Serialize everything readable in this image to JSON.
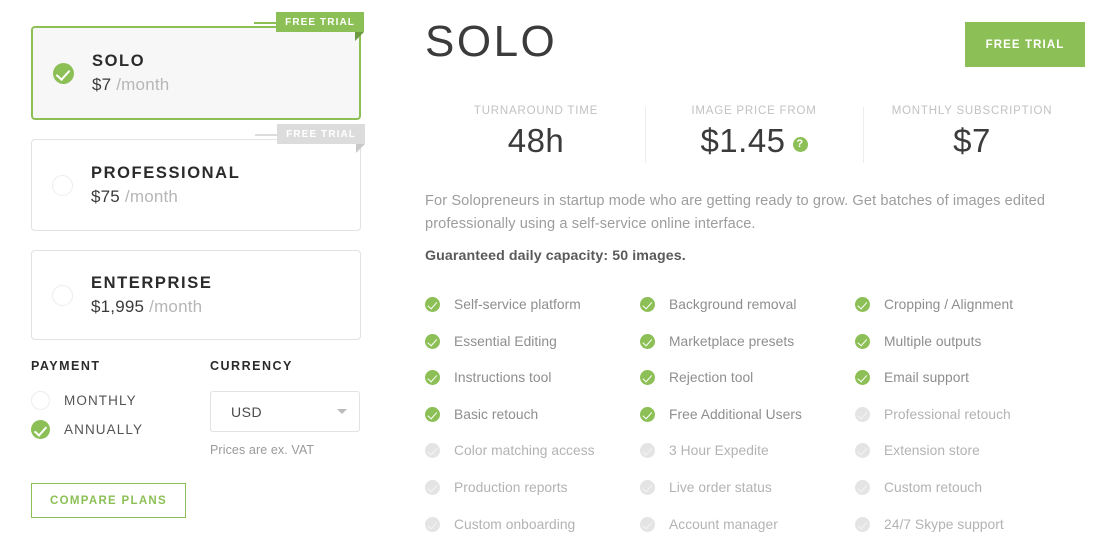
{
  "plans": [
    {
      "name": "SOLO",
      "price": "$7",
      "period": "/month",
      "badge": "FREE TRIAL",
      "selected": true,
      "badge_style": "green"
    },
    {
      "name": "PROFESSIONAL",
      "price": "$75",
      "period": "/month",
      "badge": "FREE TRIAL",
      "selected": false,
      "badge_style": "grey"
    },
    {
      "name": "ENTERPRISE",
      "price": "$1,995",
      "period": "/month",
      "badge": "",
      "selected": false,
      "badge_style": "none"
    }
  ],
  "payment": {
    "heading": "PAYMENT",
    "options": [
      {
        "label": "MONTHLY",
        "selected": false
      },
      {
        "label": "ANNUALLY",
        "selected": true
      }
    ]
  },
  "currency": {
    "heading": "CURRENCY",
    "selected": "USD",
    "options": [
      "USD"
    ],
    "note": "Prices are ex. VAT"
  },
  "compare_button": "COMPARE PLANS",
  "detail": {
    "title": "SOLO",
    "trial_button": "FREE TRIAL",
    "stats": [
      {
        "label": "TURNAROUND TIME",
        "value": "48h",
        "help": false
      },
      {
        "label": "IMAGE PRICE FROM",
        "value": "$1.45",
        "help": true,
        "help_glyph": "?"
      },
      {
        "label": "MONTHLY SUBSCRIPTION",
        "value": "$7",
        "help": false
      }
    ],
    "description": "For Solopreneurs in startup mode who are getting ready to grow. Get batches of images edited professionally using a self-service online interface.",
    "capacity": "Guaranteed daily capacity: 50 images.",
    "feature_columns": [
      [
        {
          "label": "Self-service platform",
          "included": true
        },
        {
          "label": "Essential Editing",
          "included": true
        },
        {
          "label": "Instructions tool",
          "included": true
        },
        {
          "label": "Basic retouch",
          "included": true
        },
        {
          "label": "Color matching access",
          "included": false
        },
        {
          "label": "Production reports",
          "included": false
        },
        {
          "label": "Custom onboarding",
          "included": false
        }
      ],
      [
        {
          "label": "Background removal",
          "included": true
        },
        {
          "label": "Marketplace presets",
          "included": true
        },
        {
          "label": "Rejection tool",
          "included": true
        },
        {
          "label": "Free Additional Users",
          "included": true
        },
        {
          "label": "3 Hour Expedite",
          "included": false
        },
        {
          "label": "Live order status",
          "included": false
        },
        {
          "label": "Account manager",
          "included": false
        }
      ],
      [
        {
          "label": "Cropping / Alignment",
          "included": true
        },
        {
          "label": "Multiple outputs",
          "included": true
        },
        {
          "label": "Email support",
          "included": true
        },
        {
          "label": "Professional retouch",
          "included": false
        },
        {
          "label": "Extension store",
          "included": false
        },
        {
          "label": "Custom retouch",
          "included": false
        },
        {
          "label": "24/7 Skype support",
          "included": false
        }
      ]
    ]
  },
  "colors": {
    "accent_green": "#8cc056",
    "badge_grey": "#dcdcdc",
    "text_dark": "#3b3b3b",
    "text_muted": "#9d9d9d"
  }
}
